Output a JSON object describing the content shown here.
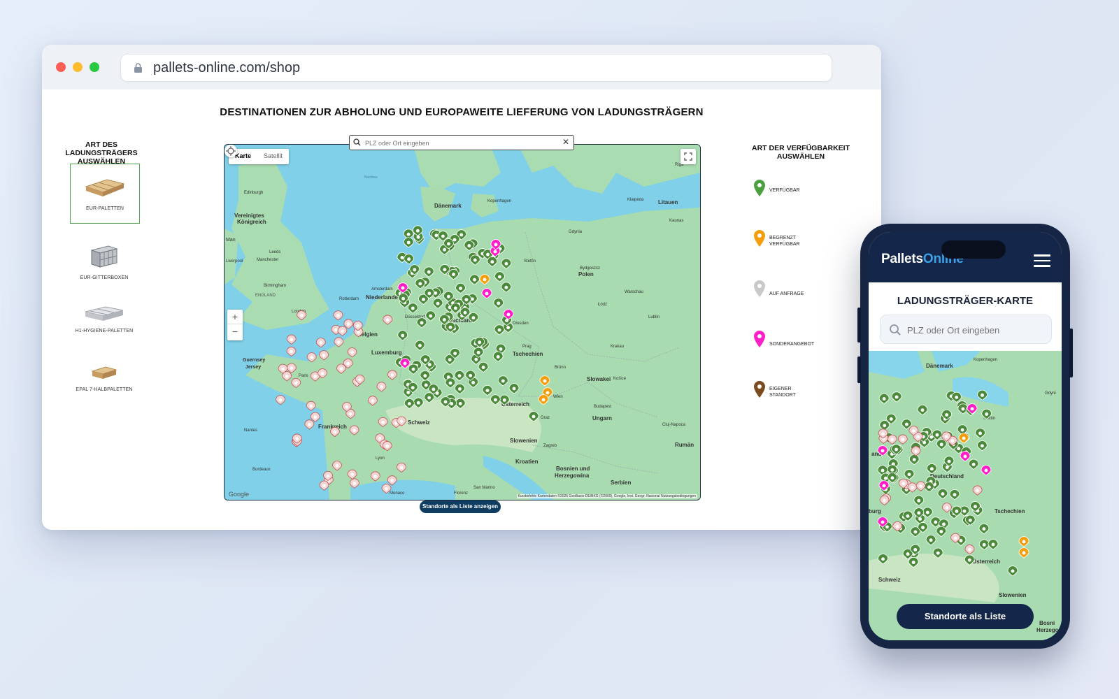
{
  "browser": {
    "url": "pallets-online.com/shop",
    "traffic_lights": [
      "#ff5f57",
      "#febc2e",
      "#28c840"
    ]
  },
  "page": {
    "title": "DESTINATIONEN ZUR ABHOLUNG UND EUROPAWEITE LIEFERUNG VON LADUNGSTRÄGERN",
    "left_heading": "ART DES LADUNGSTRÄGERS AUSWÄHLEN",
    "right_heading": "ART DER VERFÜGBARKEIT AUSWÄHLEN",
    "list_button": "Standorte als Liste anzeigen"
  },
  "pallet_types": [
    {
      "label": "EUR-PALETTEN",
      "selected": true,
      "icon": "wood-pallet"
    },
    {
      "label": "EUR-GITTERBOXEN",
      "selected": false,
      "icon": "mesh-box"
    },
    {
      "label": "H1-HYGIENE-PALETTEN",
      "selected": false,
      "icon": "plastic-pallet"
    },
    {
      "label": "EPAL 7-HALBPALETTEN",
      "selected": false,
      "icon": "half-pallet"
    }
  ],
  "availability_legend": [
    {
      "label_l1": "VERFÜGBAR",
      "label_l2": "",
      "color": "#4aa03f"
    },
    {
      "label_l1": "BEGRENZT",
      "label_l2": "VERFÜGBAR",
      "color": "#f59e0b"
    },
    {
      "label_l1": "AUF ANFRAGE",
      "label_l2": "",
      "color": "#c9c9c9"
    },
    {
      "label_l1": "SONDERANGEBOT",
      "label_l2": "",
      "color": "#ff1ec8"
    },
    {
      "label_l1": "EIGENER",
      "label_l2": "STANDORT",
      "color": "#7b4a1e"
    }
  ],
  "map": {
    "search_placeholder": "PLZ oder Ort eingeben",
    "type_map": "Karte",
    "type_satellite": "Satellit",
    "zoom_in": "+",
    "zoom_out": "−",
    "google": "Google",
    "attribution": "Kurzbefehle   Kartendaten ©2026 GeoBasis-DE/BKG (©2009), Google, Inst. Geogr. Nacional   Nutzungsbedingungen",
    "labels": {
      "nordsee": "Nordsee",
      "daenemark": "Dänemark",
      "kopenhagen": "Kopenhagen",
      "edinburgh": "Edinburgh",
      "vereinigtes1": "Vereinigtes",
      "vereinigtes2": "Königreich",
      "man": "Man",
      "leeds": "Leeds",
      "liverpool": "Liverpool",
      "manchester": "Manchester",
      "birmingham": "Birmingham",
      "england": "ENGLAND",
      "london": "London",
      "amsterdam": "Amsterdam",
      "rotterdam": "Rotterdam",
      "niederlande": "Niederlande",
      "belgien": "Belgien",
      "luxemburg": "Luxemburg",
      "guernsey": "Guernsey",
      "jersey": "Jersey",
      "deutschland": "Deutschland",
      "duesseldorf": "Düsseldorf",
      "stettin": "Stettin",
      "polen": "Polen",
      "bydgoszcz": "Bydgoszcz",
      "warschau": "Warschau",
      "lodz": "Łódź",
      "lublin": "Lublin",
      "kaunas": "Kaunas",
      "litauen": "Litauen",
      "klaipeda": "Klaipėda",
      "riga": "Riga",
      "gdynia": "Gdynia",
      "dresden": "Dresden",
      "prag": "Prag",
      "tschechien": "Tschechien",
      "krakau": "Krakau",
      "slowakei": "Slowakei",
      "kosice": "Košice",
      "bruenn": "Brünn",
      "oesterreich": "Österreich",
      "wien": "Wien",
      "graz": "Graz",
      "budapest": "Budapest",
      "ungarn": "Ungarn",
      "slowenien": "Slowenien",
      "zagreb": "Zagreb",
      "kroatien": "Kroatien",
      "bosnien1": "Bosnien und",
      "bosnien2": "Herzegowina",
      "serbien": "Serbien",
      "rumaenien": "Rumän",
      "clujnapoca": "Cluj-Napoca",
      "schweiz": "Schweiz",
      "frankreich": "Frankreich",
      "nantes": "Nantes",
      "paris": "Paris",
      "lyon": "Lyon",
      "bordeaux": "Bordeaux",
      "monaco": "Monaco",
      "florenz": "Florenz",
      "sanmarino": "San Marino"
    }
  },
  "phone": {
    "logo_part1": "Pallets",
    "logo_part2": "Online",
    "title": "LADUNGSTRÄGER-KARTE",
    "search_placeholder": "PLZ oder Ort eingeben",
    "list_button": "Standorte als Liste",
    "map_labels": {
      "daenemark": "Dänemark",
      "kopenhagen": "Kopenhagen",
      "gdynia": "Gdyni",
      "stettin": "Stettin",
      "deutschland": "Deutschland",
      "tschechien": "Tschechien",
      "oesterreich": "Österreich",
      "schweiz": "Schweiz",
      "slowenien": "Slowenien",
      "burg": "burg",
      "ande": "ande",
      "bosnien1": "Bosni",
      "bosnien2": "Herzego"
    }
  }
}
